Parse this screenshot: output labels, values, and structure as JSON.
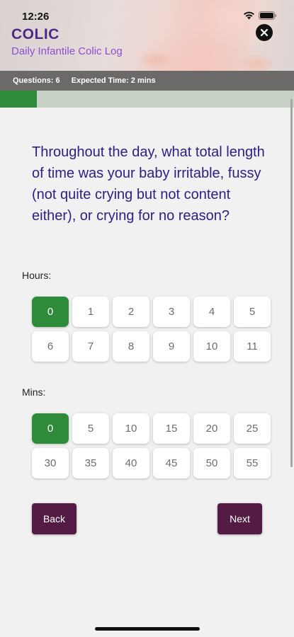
{
  "status_bar": {
    "time": "12:26",
    "icons": [
      "wifi-icon",
      "battery-icon"
    ]
  },
  "header": {
    "title": "COLIC",
    "subtitle": "Daily Infantile Colic Log",
    "close_icon": "close-icon"
  },
  "info_bar": {
    "questions": "Questions: 6",
    "expected_time": "Expected Time: 2 mins"
  },
  "progress": {
    "fraction": 0.125
  },
  "question": {
    "text": "Throughout the day, what total length of time was your baby irritable, fussy (not quite crying but not content either), or crying for no reason?"
  },
  "hours": {
    "label": "Hours:",
    "options": [
      "0",
      "1",
      "2",
      "3",
      "4",
      "5",
      "6",
      "7",
      "8",
      "9",
      "10",
      "11"
    ],
    "selected": "0"
  },
  "mins": {
    "label": "Mins:",
    "options": [
      "0",
      "5",
      "10",
      "15",
      "20",
      "25",
      "30",
      "35",
      "40",
      "45",
      "50",
      "55"
    ],
    "selected": "0"
  },
  "buttons": {
    "back": "Back",
    "next": "Next"
  },
  "colors": {
    "selected": "#2e8b39",
    "title": "#4b2a86",
    "subtitle": "#8d4fd6",
    "question": "#2f1d84",
    "nav_button": "#541c45"
  }
}
